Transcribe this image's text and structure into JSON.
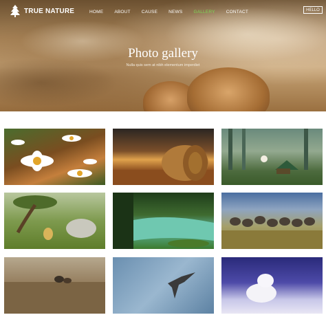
{
  "brand": {
    "name": "TRUE NATURE",
    "icon": "tree-icon"
  },
  "nav": {
    "items": [
      {
        "label": "HOME"
      },
      {
        "label": "ABOUT"
      },
      {
        "label": "CAUSE"
      },
      {
        "label": "NEWS"
      },
      {
        "label": "GALLERY"
      },
      {
        "label": "CONTACT"
      }
    ],
    "active": "GALLERY",
    "active_color": "#7ed957"
  },
  "header_button": {
    "label": "HELLO"
  },
  "hero": {
    "title": "Photo gallery",
    "subtitle": "Nulla quis sem at nibh elementum imperdiet"
  },
  "gallery": {
    "photos": [
      {
        "subject": "daisies"
      },
      {
        "subject": "hay-bale"
      },
      {
        "subject": "misty-forest-camp"
      },
      {
        "subject": "bonsai-tree-and-duckling"
      },
      {
        "subject": "forest-river"
      },
      {
        "subject": "ostrich-flock"
      },
      {
        "subject": "ducks-on-shore"
      },
      {
        "subject": "bird-over-water"
      },
      {
        "subject": "arctic-fox"
      }
    ]
  }
}
